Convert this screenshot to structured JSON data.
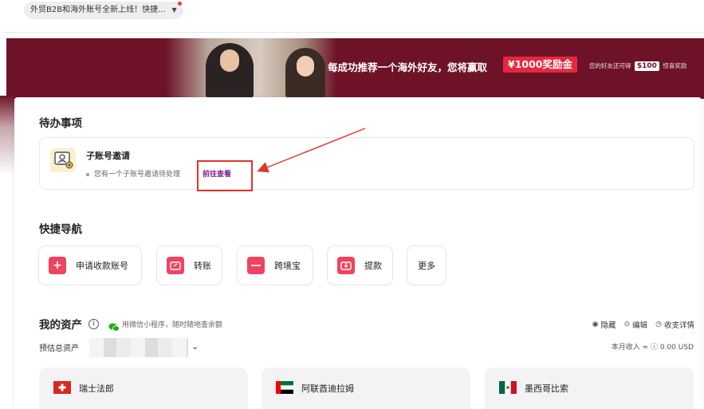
{
  "notice": {
    "text": "外贸B2B和海外账号全新上线！快捷..."
  },
  "banner": {
    "message": "每成功推荐一个海外好友，您将赢取",
    "prize": "¥1000奖励金",
    "sub_prefix": "您的好友还可得",
    "sub_badge": "$100",
    "sub_suffix": "惊喜奖励"
  },
  "todo": {
    "section_title": "待办事项",
    "item_title": "子账号邀请",
    "item_desc": "您有一个子账号邀请待处理",
    "item_link": "前往查看"
  },
  "quick_nav": {
    "section_title": "快捷导航",
    "items": [
      {
        "label": "申请收款账号",
        "icon": "plus-icon"
      },
      {
        "label": "转账",
        "icon": "transfer-icon"
      },
      {
        "label": "跨境宝",
        "icon": "wallet-icon"
      },
      {
        "label": "提款",
        "icon": "withdraw-icon"
      },
      {
        "label": "更多",
        "icon": ""
      }
    ]
  },
  "assets": {
    "title": "我的资产",
    "wechat_hint": "用微信小程序，随时随地查余额",
    "actions": [
      "隐藏",
      "编辑",
      "收支详情"
    ],
    "estimated_label": "预估总资产",
    "month_income": "本月收入 ≈ ⓘ 0.00 USD",
    "currencies": [
      {
        "name": "瑞士法郎",
        "flag": "switzerland"
      },
      {
        "name": "阿联酋迪拉姆",
        "flag": "uae"
      },
      {
        "name": "墨西哥比索",
        "flag": "mexico"
      }
    ]
  },
  "colors": {
    "banner_bg": "#6e1327",
    "prize_bg": "#e8273c",
    "accent": "#f0435f",
    "link": "#7a1f8c",
    "highlight": "#e0352b"
  }
}
